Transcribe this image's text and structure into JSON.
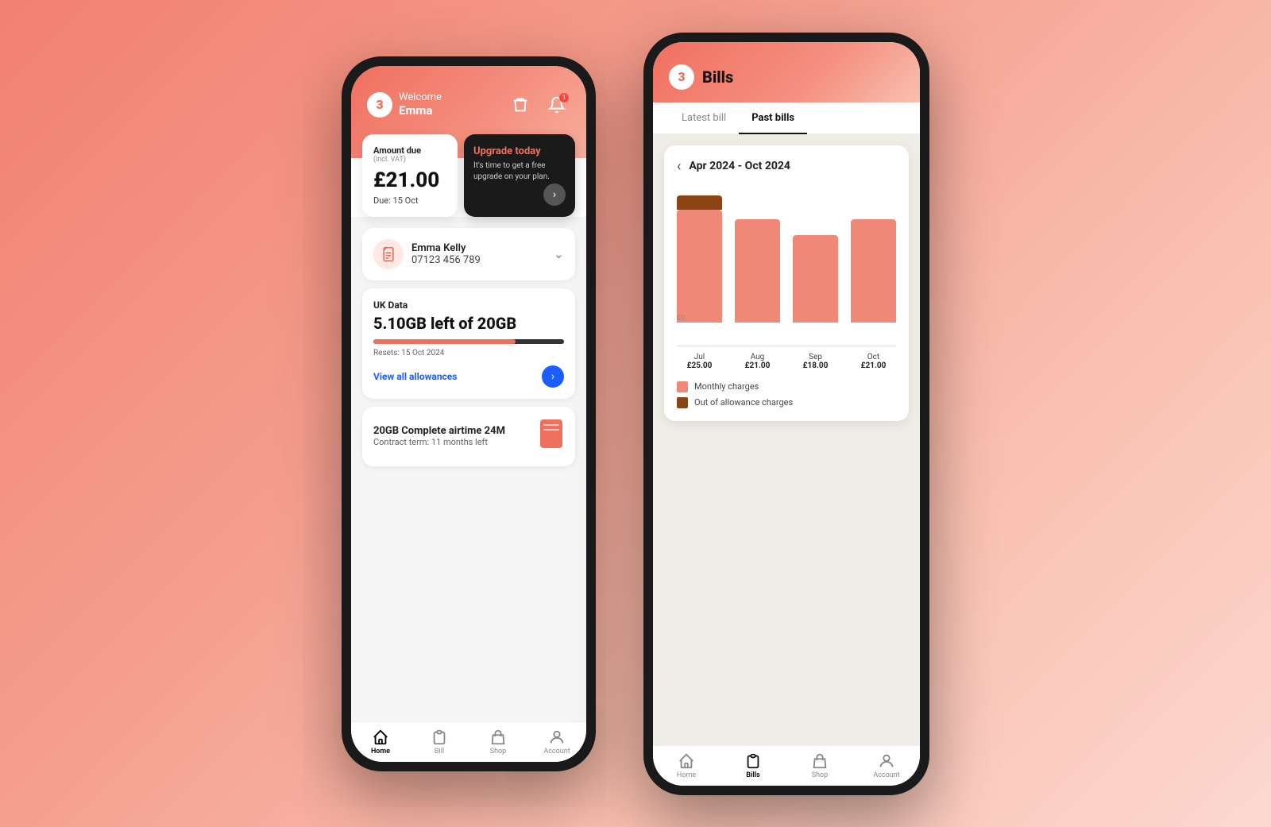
{
  "phone1": {
    "logo": "3",
    "header": {
      "welcome": "Welcome",
      "name": "Emma"
    },
    "icons": {
      "bucket": "🪣",
      "bell": "🔔",
      "notif_count": "1"
    },
    "amount_card": {
      "label": "Amount due",
      "sub_label": "(incl. VAT)",
      "value": "£21.00",
      "due": "Due: 15 Oct"
    },
    "upgrade_card": {
      "title": "Upgrade today",
      "desc": "It's time to get a free upgrade on your plan."
    },
    "sim": {
      "name": "Emma Kelly",
      "number": "07123 456 789"
    },
    "data": {
      "label": "UK Data",
      "amount": "5.10GB left of 20GB",
      "resets": "Resets: 15 Oct 2024",
      "bar_used_pct": 74.5,
      "view_allowances": "View all allowances"
    },
    "plan": {
      "name": "20GB Complete airtime 24M",
      "term": "Contract term: 11 months left"
    },
    "nav": {
      "items": [
        {
          "id": "home",
          "label": "Home",
          "active": true
        },
        {
          "id": "bill",
          "label": "Bill",
          "active": false
        },
        {
          "id": "shop",
          "label": "Shop",
          "active": false
        },
        {
          "id": "account",
          "label": "Account",
          "active": false
        }
      ]
    }
  },
  "phone2": {
    "logo": "3",
    "title": "Bills",
    "tabs": [
      {
        "label": "Latest bill",
        "active": false
      },
      {
        "label": "Past bills",
        "active": true
      }
    ],
    "chart": {
      "date_range": "Apr 2024 - Oct 2024",
      "y_label": "£0",
      "bars": [
        {
          "month": "Jul",
          "amount": "£25.00",
          "main_height": 160,
          "extra_height": 18
        },
        {
          "month": "Aug",
          "amount": "£21.00",
          "main_height": 130,
          "extra_height": 0
        },
        {
          "month": "Sep",
          "amount": "£18.00",
          "main_height": 110,
          "extra_height": 0
        },
        {
          "month": "Oct",
          "amount": "£21.00",
          "main_height": 130,
          "extra_height": 0
        }
      ],
      "legend": [
        {
          "color": "#f08878",
          "label": "Monthly charges"
        },
        {
          "color": "#8B4513",
          "label": "Out of allowance charges"
        }
      ]
    },
    "nav": {
      "items": [
        {
          "id": "home",
          "label": "Home",
          "active": false
        },
        {
          "id": "bills",
          "label": "Bills",
          "active": true
        },
        {
          "id": "shop",
          "label": "Shop",
          "active": false
        },
        {
          "id": "account",
          "label": "Account",
          "active": false
        }
      ]
    }
  }
}
